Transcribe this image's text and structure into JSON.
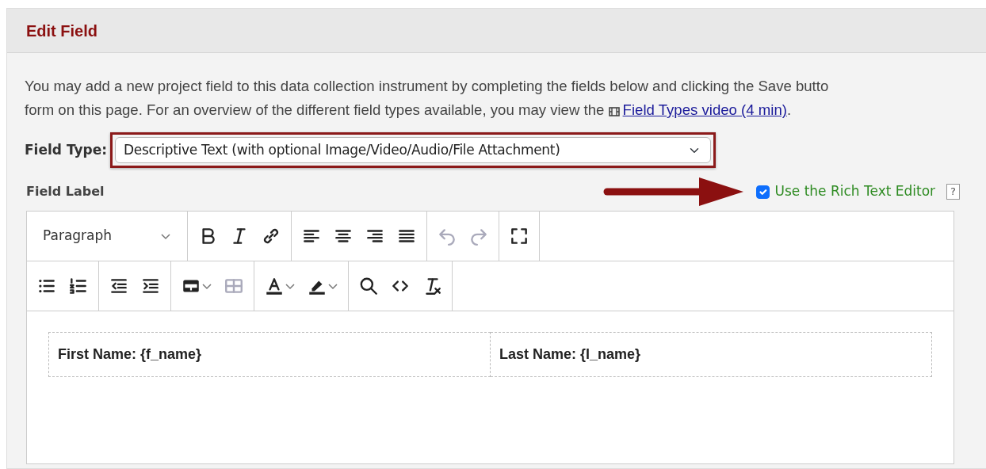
{
  "panel": {
    "title": "Edit Field"
  },
  "intro": {
    "lines": [
      "You may add a new project field to this data collection instrument by completing the fields below and clicking the Save butto",
      "form on this page. For an overview of the different field types available, you may view the"
    ],
    "link": "Field Types video (4 min)",
    "after_link": "."
  },
  "field_type": {
    "label": "Field Type:",
    "value": "Descriptive Text (with optional Image/Video/Audio/File Attachment)",
    "highlighted": true
  },
  "field_label": {
    "label": "Field Label",
    "rich_text": {
      "label": "Use the Rich Text Editor",
      "checked": true,
      "help": "?"
    }
  },
  "toolbar_rows": [
    [
      [
        {
          "kind": "block",
          "label": "Paragraph"
        }
      ],
      [
        {
          "kind": "bold",
          "disabled": false
        },
        {
          "kind": "italic",
          "disabled": false
        },
        {
          "kind": "link",
          "disabled": false
        }
      ],
      [
        {
          "kind": "align-left",
          "disabled": false
        },
        {
          "kind": "align-center",
          "disabled": false
        },
        {
          "kind": "align-right",
          "disabled": false
        },
        {
          "kind": "justify",
          "disabled": false
        }
      ],
      [
        {
          "kind": "undo",
          "disabled": true
        },
        {
          "kind": "redo",
          "disabled": true
        }
      ],
      [
        {
          "kind": "fullscreen",
          "disabled": false
        }
      ]
    ],
    [
      [
        {
          "kind": "bullets",
          "disabled": false
        },
        {
          "kind": "numbers",
          "disabled": false
        }
      ],
      [
        {
          "kind": "outdent",
          "disabled": false
        },
        {
          "kind": "indent",
          "disabled": false
        }
      ],
      [
        {
          "kind": "table",
          "disabled": false,
          "caret": true
        },
        {
          "kind": "table-props",
          "disabled": true
        }
      ],
      [
        {
          "kind": "text-color",
          "disabled": false,
          "caret": true
        },
        {
          "kind": "highlight",
          "disabled": false,
          "caret": true
        }
      ],
      [
        {
          "kind": "search",
          "disabled": false
        },
        {
          "kind": "code",
          "disabled": false
        },
        {
          "kind": "clear-format",
          "disabled": false
        }
      ]
    ]
  ],
  "content_table": [
    [
      "First Name: {f_name}",
      "Last Name: {l_name}"
    ]
  ]
}
